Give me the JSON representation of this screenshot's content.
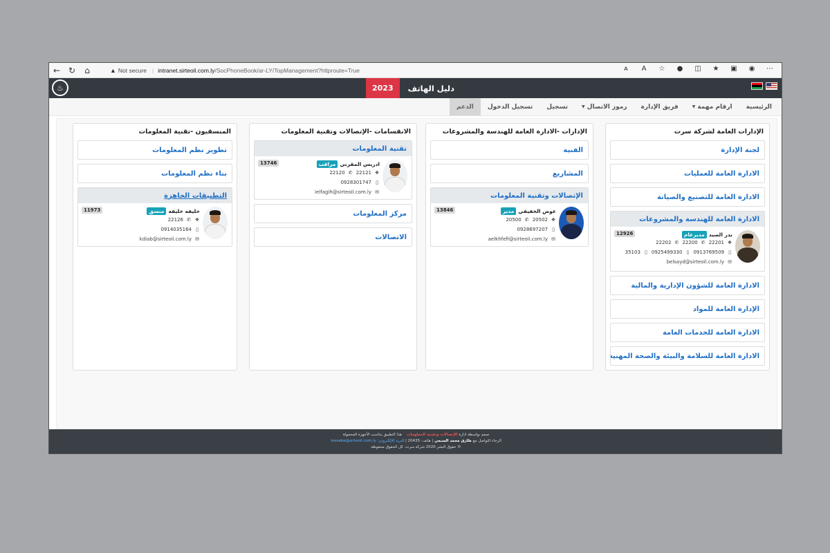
{
  "browser": {
    "not_secure": "Not secure",
    "url_host": "intranet.sirteoil.com.ly",
    "url_path": "/SocPhoneBook/ar-LY/TopManagement?httproute=True"
  },
  "header": {
    "title": "دليل الهاتف",
    "year": "2023"
  },
  "nav": {
    "home": "الرئيسية",
    "important_numbers": "ارقام مهمة",
    "management_team": "فريق الإدارة",
    "dial_codes": "رموز الاتصال",
    "register": "تسجيل",
    "login": "تسجيل الدخول",
    "support": "الدعم"
  },
  "columns": [
    {
      "heading": "الإدارات العامة لشركة سرت",
      "units_before": [
        "لجنة الإدارة",
        "الادارة العامة للعمليات",
        "الادارة العامة للتصنيع والصيانة"
      ],
      "card": {
        "title": "الادارة العامة للهندسة والمشروعات",
        "person": {
          "name": "بدر الصيد",
          "role": "مديرعام",
          "ext": "12926",
          "phones": [
            "22201",
            "22200",
            "22202"
          ],
          "mobiles": [
            "0913769509",
            "0925499330",
            "35103"
          ],
          "email": "belsayd@sirteoil.com.ly"
        }
      },
      "units_after": [
        "الادارة العامة للشؤون الإدارية والمالية",
        "الإدارة العامة للمواد",
        "الادارة العامة للخدمات العامة",
        "الادارة العامة للسلامة والبيئة والصحة المهنية"
      ]
    },
    {
      "heading": "الإدارات -الادارة العامة للهندسة والمشروعات",
      "units_before": [
        "الفنية",
        "المشاريع"
      ],
      "card": {
        "title": "الإتصالات وتقنية المعلومات",
        "person": {
          "name": "عوض الخفيفي",
          "role": "مدير",
          "ext": "13846",
          "phones": [
            "20502",
            "20500"
          ],
          "mobiles": [
            "0928697207"
          ],
          "email": "aelkhfefi@sirteoil.com.ly"
        }
      }
    },
    {
      "heading": "الانقسامات -الإتصالات وتقنية المعلومات",
      "card": {
        "title": "تقنية المعلومات",
        "person": {
          "name": "ادريس المقرني",
          "role": "مراقب",
          "ext": "13746",
          "phones": [
            "22121",
            "22120"
          ],
          "mobiles": [
            "0928301747"
          ],
          "email": "ielfagih@sirteoil.com.ly"
        }
      },
      "units_after": [
        "مركز المعلومات",
        "الاتصالات"
      ]
    },
    {
      "heading": "المنسقيون -تقنية المعلومات",
      "units_before": [
        "تطوير نظم المعلومات",
        "بناء نظم المعلومات"
      ],
      "card": {
        "title": "التطبيقات الجاهزة",
        "person": {
          "name": "خليفه خليفه",
          "role": "منسق",
          "ext": "11973",
          "phones": [
            "22126"
          ],
          "mobiles": [
            "0914035164"
          ],
          "email": "kdiab@sirteoil.com.ly"
        }
      }
    }
  ],
  "footer": {
    "line1_a": "صمم بواسطة ادارة",
    "line1_b": "الإتصالات وتقنية المعلومات",
    "line1_c": "هذا التطبيق يتناسب الأجهزة المحمولة",
    "line2_a": "الرجاء التواصل مع",
    "line2_name": "طارق محمد السبعي",
    "line2_phone": "هاتف: 20435",
    "line2_email_label": "البريد الإلكتروني:",
    "line2_email": "tessebe@sirteoil.com.ly",
    "line3": "© حقوق النشر 2020 شركة سرت. كل الحقوق محفوظة"
  }
}
